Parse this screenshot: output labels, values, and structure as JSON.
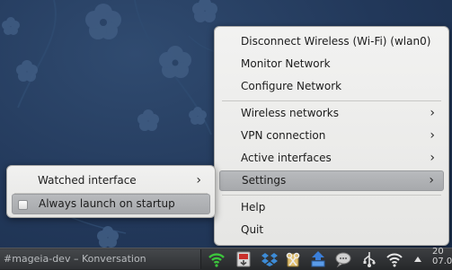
{
  "main_menu": {
    "items": [
      {
        "label": "Disconnect Wireless (Wi-Fi) (wlan0)",
        "submenu": false
      },
      {
        "label": "Monitor Network",
        "submenu": false
      },
      {
        "label": "Configure Network",
        "submenu": false
      },
      {
        "label": "Wireless networks",
        "submenu": true
      },
      {
        "label": "VPN connection",
        "submenu": true
      },
      {
        "label": "Active interfaces",
        "submenu": true
      },
      {
        "label": "Settings",
        "submenu": true,
        "highlighted": true
      },
      {
        "label": "Help",
        "submenu": false
      },
      {
        "label": "Quit",
        "submenu": false
      }
    ],
    "chevron": "›"
  },
  "settings_submenu": {
    "watched_interface_label": "Watched interface",
    "always_launch_label": "Always launch on startup",
    "always_launch_checked": false
  },
  "taskbar": {
    "task_label": "#mageia-dev – Konversation",
    "tray_icons": [
      "network-wifi-icon",
      "package-update-icon",
      "dropbox-icon",
      "klipper-icon",
      "upload-icon",
      "chat-bubble-icon",
      "usb-icon",
      "wifi-signal-icon",
      "expand-arrow-icon"
    ],
    "clock_line1": "20",
    "clock_line2": "07.0"
  },
  "colors": {
    "desktop_bg": "#22385a",
    "flower_fill": "#3e5a80",
    "menu_bg": "#ececea",
    "highlight": "#aeb0b3",
    "taskbar_bg": "#2e3033",
    "wifi_green": "#3cc43c"
  }
}
